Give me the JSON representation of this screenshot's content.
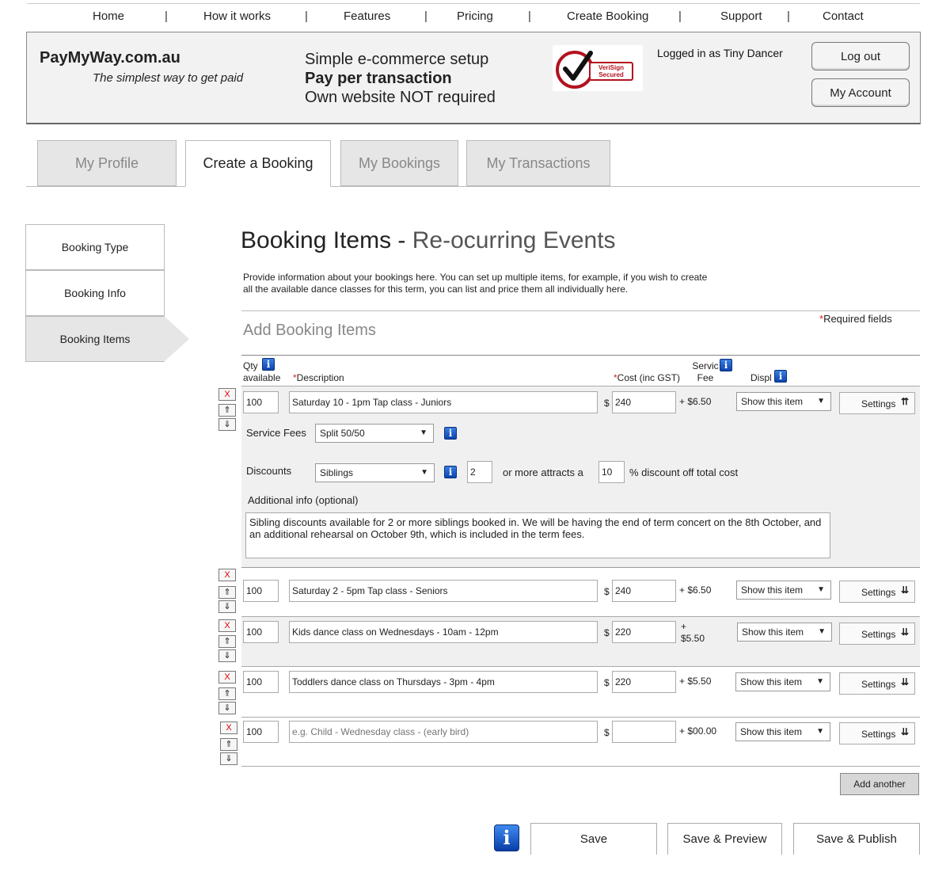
{
  "nav": {
    "items": [
      "Home",
      "How it works",
      "Features",
      "Pricing",
      "Create Booking",
      "Support",
      "Contact"
    ],
    "separator": "|"
  },
  "header": {
    "site_name": "PayMyWay.com.au",
    "tagline": "The simplest way to get paid",
    "pitch": [
      "Simple e-commerce setup",
      "Pay per transaction",
      "Own website NOT required"
    ],
    "seal_text": [
      "VeriSign",
      "Secured"
    ],
    "logged_in": "Logged in as Tiny Dancer",
    "logout": "Log out",
    "account": "My Account"
  },
  "tabs": [
    "My Profile",
    "Create a Booking",
    "My Bookings",
    "My Transactions"
  ],
  "active_tab": "Create a Booking",
  "steps": [
    "Booking Type",
    "Booking Info",
    "Booking Items"
  ],
  "active_step": "Booking Items",
  "page": {
    "title": "Booking Items - ",
    "subtitle": "Re-ocurring Events",
    "intro": "Provide information about your bookings here. You can set up multiple items, for example, if you wish to create all the available dance classes for this term, you can list and price them all individually here.",
    "section": "Add Booking Items",
    "required": "Required fields",
    "required_star": "*"
  },
  "columns": {
    "qty_1": "Qty",
    "qty_2": "available",
    "description": "Description",
    "cost": "Cost (inc GST)",
    "service_1": "Servic",
    "service_2": "Fee",
    "display": "Displ"
  },
  "expanded": {
    "service_fees_label": "Service Fees",
    "service_fees_value": "Split 50/50",
    "discounts_label": "Discounts",
    "discount_type": "Siblings",
    "discount_min": "2",
    "discount_mid": "or more attracts a",
    "discount_pct": "10",
    "discount_tail": "% discount off total cost",
    "additional_label": "Additional info (optional)",
    "additional_text": "Sibling discounts available for 2 or more siblings booked in.   We will be having the end of term concert on the 8th October, and an additional rehearsal on October 9th, which is included in the term fees."
  },
  "items": [
    {
      "qty": "100",
      "description": "Saturday 10 - 1pm Tap class - Juniors",
      "cost": "240",
      "fee": "+ $6.50",
      "display": "Show this item",
      "settings": "Settings"
    },
    {
      "qty": "100",
      "description": "Saturday 2 - 5pm Tap class - Seniors",
      "cost": "240",
      "fee": "+ $6.50",
      "display": "Show this item",
      "settings": "Settings"
    },
    {
      "qty": "100",
      "description": "Kids dance class on Wednesdays - 10am - 12pm",
      "cost": "220",
      "fee_1": "+",
      "fee_2": "$5.50",
      "display": "Show this item",
      "settings": "Settings"
    },
    {
      "qty": "100",
      "description": "Toddlers dance class on Thursdays - 3pm - 4pm",
      "cost": "220",
      "fee": "+ $5.50",
      "display": "Show this item",
      "settings": "Settings"
    },
    {
      "qty": "100",
      "description": "",
      "placeholder": "e.g. Child - Wednesday class - (early bird)",
      "cost": "",
      "fee": "+ $00.00",
      "display": "Show this item",
      "settings": "Settings"
    }
  ],
  "symbols": {
    "dollar": "$",
    "delete": "X",
    "up": "⇑",
    "down": "⇓",
    "triangle": "▼",
    "expand": "⇊",
    "collapse": "⇈",
    "info": "i"
  },
  "add_another": "Add another",
  "actions": {
    "save": "Save",
    "save_preview": "Save & Preview",
    "save_publish": "Save & Publish"
  }
}
